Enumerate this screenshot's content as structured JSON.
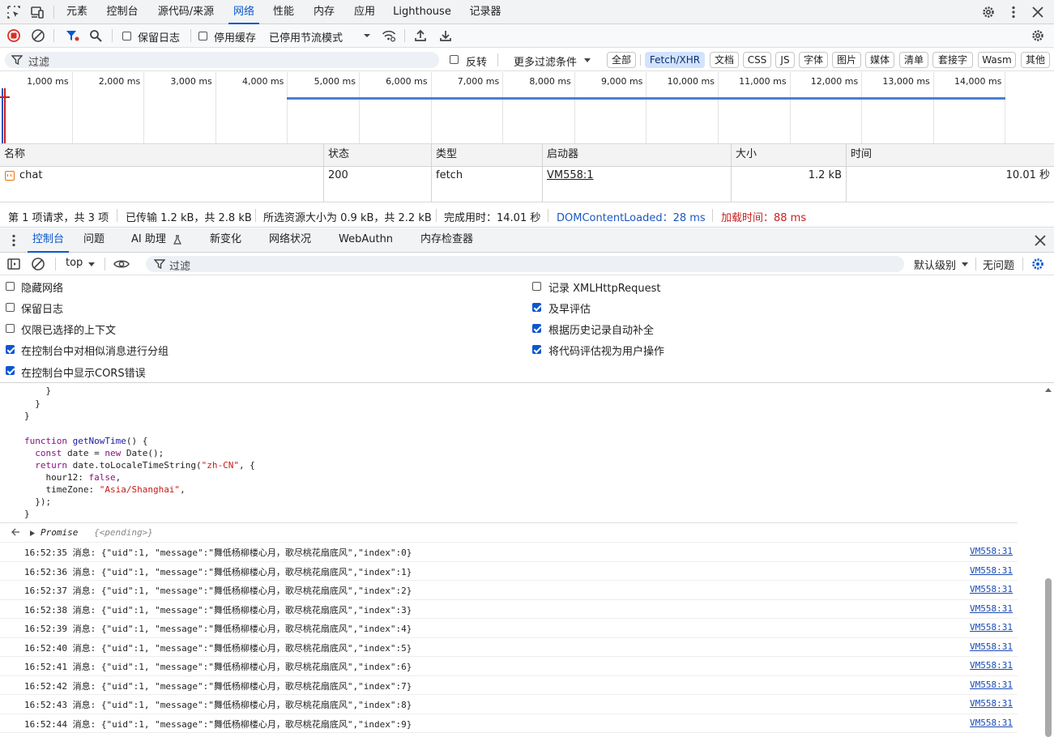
{
  "top_tabs": [
    "元素",
    "控制台",
    "源代码/来源",
    "网络",
    "性能",
    "内存",
    "应用",
    "Lighthouse",
    "记录器"
  ],
  "active_top_tab": "网络",
  "network_toolbar": {
    "preserve_log": "保留日志",
    "disable_cache": "停用缓存",
    "throttling": "已停用节流模式"
  },
  "filter_row": {
    "placeholder": "过滤",
    "invert": "反转",
    "more_filters": "更多过滤条件",
    "chips": [
      "全部",
      "Fetch/XHR",
      "文档",
      "CSS",
      "JS",
      "字体",
      "图片",
      "媒体",
      "清单",
      "套接字",
      "Wasm",
      "其他"
    ],
    "active_chip": "Fetch/XHR"
  },
  "timeline": {
    "ticks": [
      "1,000 ms",
      "2,000 ms",
      "3,000 ms",
      "4,000 ms",
      "5,000 ms",
      "6,000 ms",
      "7,000 ms",
      "8,000 ms",
      "9,000 ms",
      "10,000 ms",
      "11,000 ms",
      "12,000 ms",
      "13,000 ms",
      "14,000 ms",
      "15,0"
    ],
    "bar_start_ms": 4000,
    "bar_end_ms": 14010
  },
  "request_table": {
    "columns": [
      "名称",
      "状态",
      "类型",
      "启动器",
      "大小",
      "时间"
    ],
    "rows": [
      {
        "name": "chat",
        "status": "200",
        "type": "fetch",
        "initiator": "VM558:1",
        "size": "1.2 kB",
        "time": "10.01 秒"
      }
    ]
  },
  "summary": {
    "requests": "第 1 项请求，共 3 项",
    "transferred": "已传输 1.2 kB，共 2.8 kB",
    "resources": "所选资源大小为 0.9 kB，共 2.2 kB",
    "finish": "完成用时：14.01 秒",
    "dom_loaded": "DOMContentLoaded：28 ms",
    "load": "加载时间：88 ms"
  },
  "drawer_tabs": [
    "控制台",
    "问题",
    "AI 助理",
    "新变化",
    "网络状况",
    "WebAuthn",
    "内存检查器"
  ],
  "active_drawer_tab": "控制台",
  "console_toolbar": {
    "context": "top",
    "filter_placeholder": "过滤",
    "level": "默认级别",
    "issues": "无问题"
  },
  "console_settings": {
    "left": [
      {
        "label": "隐藏网络",
        "checked": false
      },
      {
        "label": "保留日志",
        "checked": false
      },
      {
        "label": "仅限已选择的上下文",
        "checked": false
      },
      {
        "label": "在控制台中对相似消息进行分组",
        "checked": true
      },
      {
        "label": "在控制台中显示CORS错误",
        "checked": true
      }
    ],
    "right": [
      {
        "label": "记录 XMLHttpRequest",
        "checked": false
      },
      {
        "label": "及早评估",
        "checked": true
      },
      {
        "label": "根据历史记录自动补全",
        "checked": true
      },
      {
        "label": "将代码评估视为用户操作",
        "checked": true
      }
    ]
  },
  "console_code": {
    "line1": "    }",
    "line2": "  }",
    "line3": "}",
    "fn_kw": "function",
    "fn_name": "getNowTime",
    "fn_rest": "() {",
    "l2_kw": "const",
    "l2_a": " date = ",
    "l2_new": "new",
    "l2_b": " Date();",
    "l3_kw": "return",
    "l3_a": " date.toLocaleTimeString(",
    "l3_str": "\"zh-CN\"",
    "l3_b": ", {",
    "l4": "    hour12: ",
    "l4_kw": "false",
    "l4_b": ",",
    "l5": "    timeZone: ",
    "l5_str": "\"Asia/Shanghai\"",
    "l5_b": ",",
    "l6": "  });",
    "l7": "}"
  },
  "promise_result": {
    "label": "Promise",
    "state": "{<pending>}"
  },
  "console_logs": [
    {
      "text": "16:52:35 消息: {\"uid\":1, \"message\":\"舞低杨柳楼心月，歌尽桃花扇底风\",\"index\":0}",
      "source": "VM558:31"
    },
    {
      "text": "16:52:36 消息: {\"uid\":1, \"message\":\"舞低杨柳楼心月，歌尽桃花扇底风\",\"index\":1}",
      "source": "VM558:31"
    },
    {
      "text": "16:52:37 消息: {\"uid\":1, \"message\":\"舞低杨柳楼心月，歌尽桃花扇底风\",\"index\":2}",
      "source": "VM558:31"
    },
    {
      "text": "16:52:38 消息: {\"uid\":1, \"message\":\"舞低杨柳楼心月，歌尽桃花扇底风\",\"index\":3}",
      "source": "VM558:31"
    },
    {
      "text": "16:52:39 消息: {\"uid\":1, \"message\":\"舞低杨柳楼心月，歌尽桃花扇底风\",\"index\":4}",
      "source": "VM558:31"
    },
    {
      "text": "16:52:40 消息: {\"uid\":1, \"message\":\"舞低杨柳楼心月，歌尽桃花扇底风\",\"index\":5}",
      "source": "VM558:31"
    },
    {
      "text": "16:52:41 消息: {\"uid\":1, \"message\":\"舞低杨柳楼心月，歌尽桃花扇底风\",\"index\":6}",
      "source": "VM558:31"
    },
    {
      "text": "16:52:42 消息: {\"uid\":1, \"message\":\"舞低杨柳楼心月，歌尽桃花扇底风\",\"index\":7}",
      "source": "VM558:31"
    },
    {
      "text": "16:52:43 消息: {\"uid\":1, \"message\":\"舞低杨柳楼心月，歌尽桃花扇底风\",\"index\":8}",
      "source": "VM558:31"
    },
    {
      "text": "16:52:44 消息: {\"uid\":1, \"message\":\"舞低杨柳楼心月，歌尽桃花扇底风\",\"index\":9}",
      "source": "VM558:31"
    }
  ],
  "colors": {
    "accent": "#0b57d0",
    "record_red": "#d93025",
    "timeline_bar": "#4a7fd6",
    "dom_loaded": "#1a57c2",
    "load": "#c5221f"
  },
  "icons": [
    "inspect-icon",
    "device-toggle-icon",
    "gear-icon",
    "more-vert-icon",
    "close-icon",
    "record-stop-icon",
    "clear-icon",
    "filter-icon",
    "search-icon",
    "wifi-settings-icon",
    "upload-icon",
    "download-icon",
    "sidebar-icon",
    "eye-icon"
  ]
}
